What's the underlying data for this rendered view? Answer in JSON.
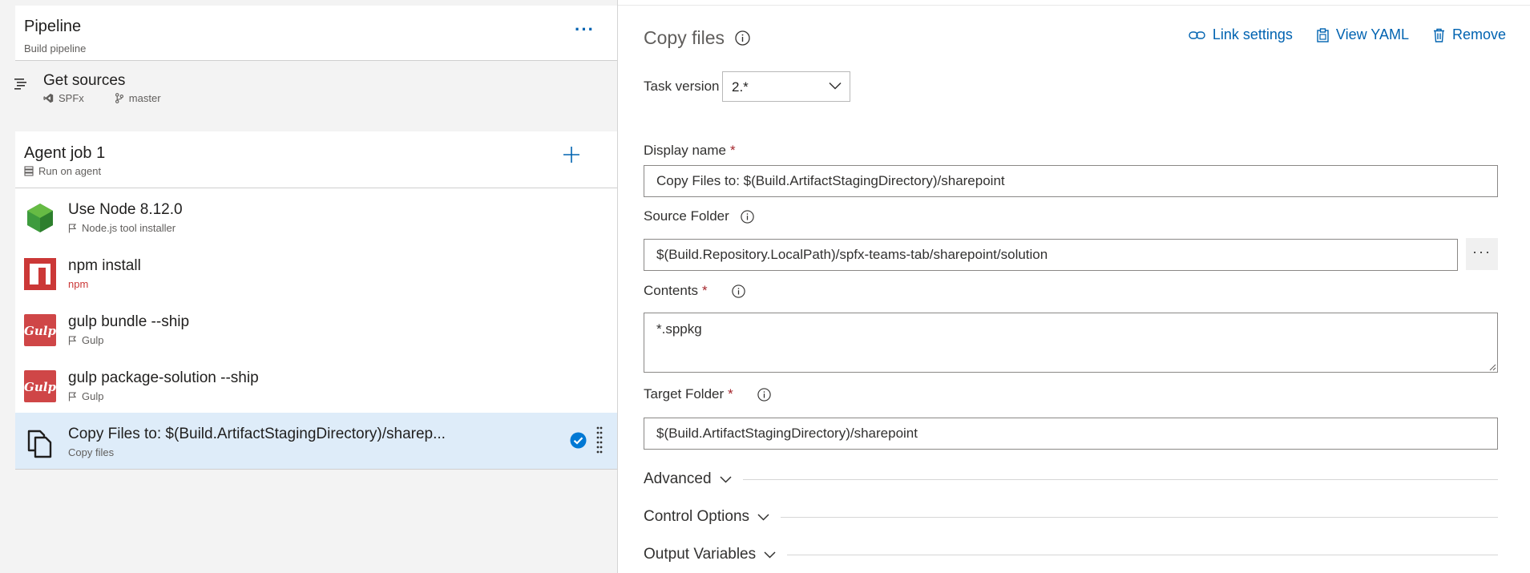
{
  "pipeline": {
    "title": "Pipeline",
    "subtitle": "Build pipeline",
    "more": "···"
  },
  "sources": {
    "title": "Get sources",
    "repo": "SPFx",
    "branch": "master"
  },
  "job": {
    "title": "Agent job 1",
    "subtitle": "Run on agent"
  },
  "tasks": [
    {
      "title": "Use Node 8.12.0",
      "subtitle": "Node.js tool installer",
      "icon": "nodejs-icon"
    },
    {
      "title": "npm install",
      "subtitle": "npm",
      "icon": "npm-icon"
    },
    {
      "title": "gulp bundle --ship",
      "subtitle": "Gulp",
      "icon": "gulp-icon"
    },
    {
      "title": "gulp package-solution --ship",
      "subtitle": "Gulp",
      "icon": "gulp-icon"
    },
    {
      "title": "Copy Files to: $(Build.ArtifactStagingDirectory)/sharep...",
      "subtitle": "Copy files",
      "icon": "copy-files-icon",
      "selected": true
    }
  ],
  "detail": {
    "title": "Copy files",
    "actions": {
      "link_settings": "Link settings",
      "view_yaml": "View YAML",
      "remove": "Remove"
    },
    "task_version": {
      "label": "Task version",
      "value": "2.*"
    },
    "display_name": {
      "label": "Display name",
      "required": "*",
      "value": "Copy Files to: $(Build.ArtifactStagingDirectory)/sharepoint"
    },
    "source_folder": {
      "label": "Source Folder",
      "value": "$(Build.Repository.LocalPath)/spfx-teams-tab/sharepoint/solution",
      "browse": "···"
    },
    "contents": {
      "label": "Contents",
      "required": "*",
      "value": "*.sppkg"
    },
    "target_folder": {
      "label": "Target Folder",
      "required": "*",
      "value": "$(Build.ArtifactStagingDirectory)/sharepoint"
    },
    "sections": {
      "advanced": "Advanced",
      "control_options": "Control Options",
      "output_variables": "Output Variables"
    }
  },
  "colors": {
    "accent": "#0063b1",
    "selected_bg": "#deecf9",
    "required": "#a4262c",
    "check": "#0078d4"
  }
}
